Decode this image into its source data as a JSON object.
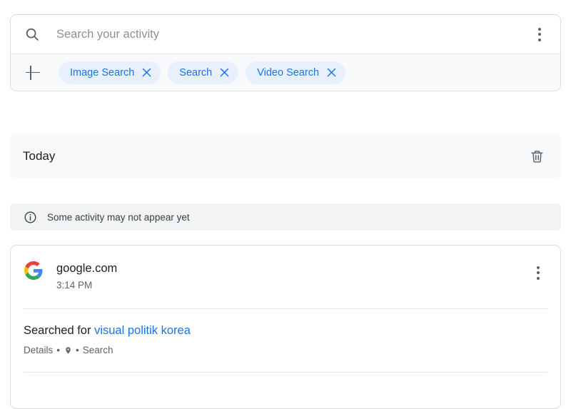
{
  "search": {
    "icon": "search-icon",
    "placeholder": "Search your activity",
    "value": "",
    "menu_icon": "more-vert-icon",
    "add_filter_icon": "plus-icon",
    "chips": [
      {
        "label": "Image Search",
        "remove_icon": "close-icon"
      },
      {
        "label": "Search",
        "remove_icon": "close-icon"
      },
      {
        "label": "Video Search",
        "remove_icon": "close-icon"
      }
    ]
  },
  "today": {
    "label": "Today",
    "delete_icon": "trash-icon"
  },
  "notice": {
    "icon": "info-icon",
    "text": "Some activity may not appear yet"
  },
  "activity": {
    "favicon": "google-logo-icon",
    "site": "google.com",
    "time": "3:14 PM",
    "menu_icon": "more-vert-icon",
    "action_label": "Searched for",
    "query": "visual politik korea",
    "meta": {
      "details_label": "Details",
      "separator": "•",
      "location_icon": "location-pin-icon",
      "type_label": "Search"
    }
  },
  "colors": {
    "accent_blue": "#1a73e8",
    "chip_bg": "#e8f0fe",
    "surface_gray": "#f8f9fa",
    "banner_gray": "#f1f3f4",
    "text_primary": "#202124",
    "text_secondary": "#5f6368",
    "border": "#dadce0"
  }
}
